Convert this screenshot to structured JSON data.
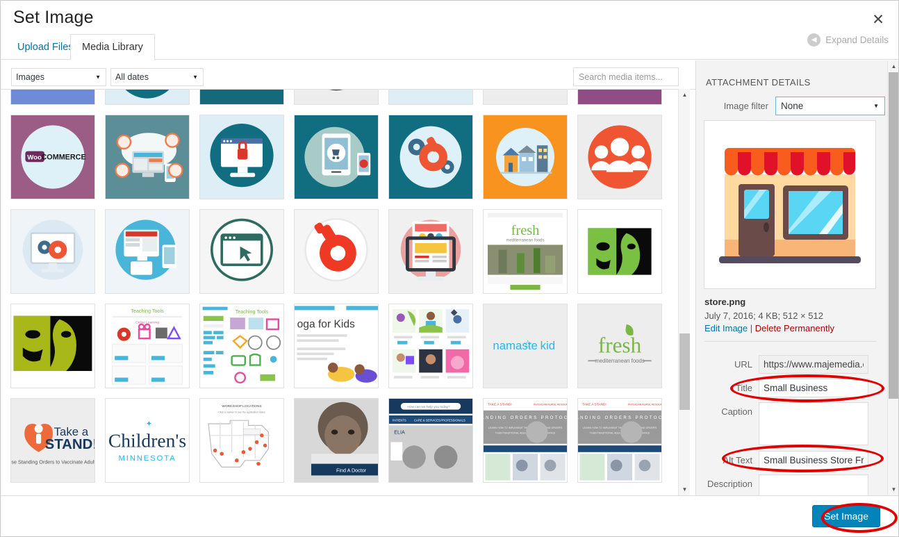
{
  "modal": {
    "title": "Set Image",
    "close_icon": "close-icon",
    "expand_details_label": "Expand Details",
    "expand_icon": "chevron-left-circle-icon"
  },
  "tabs": [
    {
      "label": "Upload Files",
      "active": false
    },
    {
      "label": "Media Library",
      "active": true
    }
  ],
  "toolbar": {
    "type_filter": "Images",
    "date_filter": "All dates",
    "search_placeholder": "Search media items...",
    "search_value": "",
    "caret_icon": "chevron-down-icon"
  },
  "grid": {
    "items": [
      {
        "name": "wp-logo-blue-circle",
        "alt": "Blue circle logo graphic"
      },
      {
        "name": "desktop-monitor-teal",
        "alt": "Teal circle with desktop monitor"
      },
      {
        "name": "responsive-devices-dark",
        "alt": "Dark teal responsive devices graphic"
      },
      {
        "name": "wordpress-logo-gray",
        "alt": "WordPress W logo on gray"
      },
      {
        "name": "orange-circle-person",
        "alt": "Orange circle with person"
      },
      {
        "name": "wordpress-logo-gray-2",
        "alt": "WordPress W logo on gray"
      },
      {
        "name": "purple-circle-graphic",
        "alt": "Purple circle graphic"
      },
      {
        "name": "woocommerce-logo",
        "alt": "WooCommerce logo on purple"
      },
      {
        "name": "cloud-security-devices",
        "alt": "Cloud computing with security badges"
      },
      {
        "name": "secure-browser-lock",
        "alt": "Monitor with red padlock"
      },
      {
        "name": "mobile-ecommerce-cart",
        "alt": "Tablet and phone with shopping cart"
      },
      {
        "name": "gears-wrench-maintenance",
        "alt": "Gears and wrench maintenance icon"
      },
      {
        "name": "small-business-storefronts",
        "alt": "Row of small shop buildings on orange"
      },
      {
        "name": "users-group-red",
        "alt": "Group of three people icon in red"
      },
      {
        "name": "monitor-gear-wrench",
        "alt": "Monitor with gear and wrench"
      },
      {
        "name": "responsive-design-devices",
        "alt": "Responsive web design devices"
      },
      {
        "name": "browser-cursor-window",
        "alt": "Browser window with cursor"
      },
      {
        "name": "red-wrench-gear",
        "alt": "Red wrench and gear icon"
      },
      {
        "name": "web-page-mockup-pink",
        "alt": "Monitor with webpage mockup on pink"
      },
      {
        "name": "fresh-mediterranean-site",
        "alt": "Fresh Mediterranean Foods website screenshot"
      },
      {
        "name": "green-portrait-poster",
        "alt": "Green duotone portrait artwork"
      },
      {
        "name": "olive-portrait-poster",
        "alt": "Olive duotone portrait artwork"
      },
      {
        "name": "teaching-tools-page",
        "alt": "Teaching Tools web page screenshot"
      },
      {
        "name": "teaching-tools-grid",
        "alt": "Teaching Tools resource grid screenshot"
      },
      {
        "name": "yoga-for-kids-page",
        "alt": "Yoga for Kids landing page"
      },
      {
        "name": "yoga-shop-products",
        "alt": "Yoga shop product listing"
      },
      {
        "name": "namaste-kid-logo",
        "alt": "Namaste Kid logo"
      },
      {
        "name": "fresh-foods-logo",
        "alt": "fresh mediterranean foods logo"
      },
      {
        "name": "take-a-stand-logo",
        "alt": "Take a STAND! vaccination logo"
      },
      {
        "name": "childrens-minnesota-logo",
        "alt": "Children's Minnesota logo"
      },
      {
        "name": "us-map-locations",
        "alt": "United States map with location markers"
      },
      {
        "name": "child-find-a-doctor",
        "alt": "Child photo with Find A Doctor banner"
      },
      {
        "name": "children-search-site",
        "alt": "Children's hospital site with search"
      },
      {
        "name": "standing-orders-protocol",
        "alt": "Standing Orders Protocol page"
      },
      {
        "name": "standing-orders-protocol-2",
        "alt": "Standing Orders Protocol page duplicate"
      }
    ]
  },
  "details": {
    "heading": "ATTACHMENT DETAILS",
    "image_filter_label": "Image filter",
    "image_filter_value": "None",
    "preview_alt": "Small business store front illustration",
    "file_name": "store.png",
    "file_meta": "July 7, 2016; 4 KB; 512 × 512",
    "edit_image_label": "Edit Image",
    "separator": "|",
    "delete_label": "Delete Permanently",
    "fields": {
      "url_label": "URL",
      "url_value": "https://www.majemedia.co",
      "title_label": "Title",
      "title_value": "Small Business",
      "caption_label": "Caption",
      "caption_value": "",
      "alt_label": "Alt Text",
      "alt_value": "Small Business Store Front",
      "description_label": "Description",
      "description_value": ""
    }
  },
  "footer": {
    "set_image_label": "Set Image"
  },
  "colors": {
    "accent_blue": "#0085ba",
    "link_blue": "#0073aa",
    "annotation_red": "#e00000",
    "delete_red": "#a00000"
  },
  "annotations": [
    {
      "name": "annotation-title-field",
      "target": "Title"
    },
    {
      "name": "annotation-alt-text-field",
      "target": "Alt Text"
    },
    {
      "name": "annotation-set-image-button",
      "target": "Set Image"
    }
  ]
}
